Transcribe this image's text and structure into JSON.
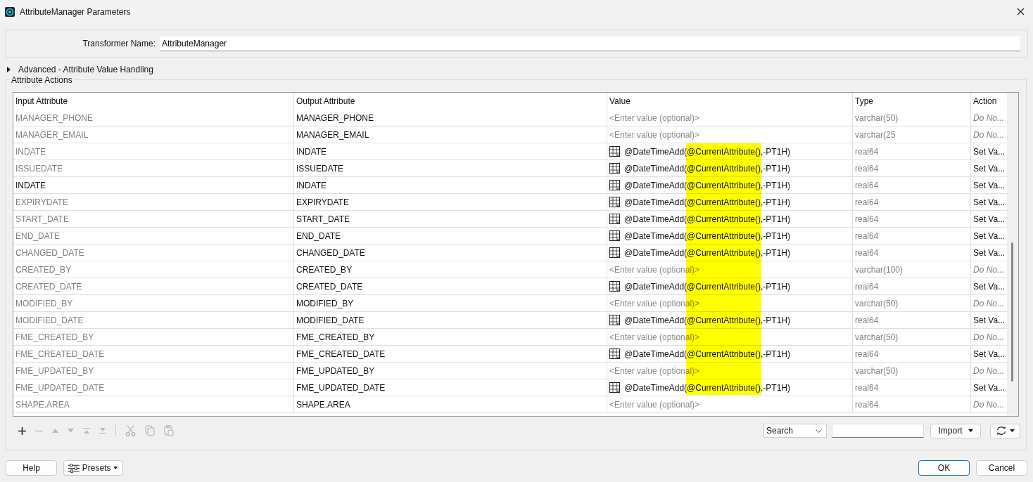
{
  "window": {
    "title": "AttributeManager Parameters"
  },
  "transformer_name": {
    "label": "Transformer Name:",
    "value": "AttributeManager"
  },
  "advanced": {
    "label": "Advanced - Attribute Value Handling",
    "expanded": false
  },
  "attribute_actions": {
    "title": "Attribute Actions",
    "highlight": true,
    "columns": [
      "Input Attribute",
      "Output Attribute",
      "Value",
      "Type",
      "Action"
    ],
    "rows": [
      {
        "input": "MANAGER_PHONE",
        "dimmed": true,
        "output": "MANAGER_PHONE",
        "kind": "placeholder",
        "value": "<Enter value (optional)>",
        "type": "varchar(50)",
        "action": "Do No...",
        "action_set": false
      },
      {
        "input": "MANAGER_EMAIL",
        "dimmed": true,
        "output": "MANAGER_EMAIL",
        "kind": "placeholder",
        "value": "<Enter value (optional)>",
        "type": "varchar(25",
        "action": "Do No...",
        "action_set": false
      },
      {
        "input": "INDATE",
        "dimmed": true,
        "output": "INDATE",
        "kind": "expression",
        "value": "@DateTimeAdd(@CurrentAttribute(),-PT1H)",
        "type": "real64",
        "action": "Set Va...",
        "action_set": true
      },
      {
        "input": "ISSUEDATE",
        "dimmed": true,
        "output": "ISSUEDATE",
        "kind": "expression",
        "value": "@DateTimeAdd(@CurrentAttribute(),-PT1H)",
        "type": "real64",
        "action": "Set Va...",
        "action_set": true
      },
      {
        "input": "INDATE",
        "dimmed": false,
        "output": "INDATE",
        "kind": "expression",
        "value": "@DateTimeAdd(@CurrentAttribute(),-PT1H)",
        "type": "real64",
        "action": "Set Va...",
        "action_set": true
      },
      {
        "input": "EXPIRYDATE",
        "dimmed": true,
        "output": "EXPIRYDATE",
        "kind": "expression",
        "value": "@DateTimeAdd(@CurrentAttribute(),-PT1H)",
        "type": "real64",
        "action": "Set Va...",
        "action_set": true
      },
      {
        "input": "START_DATE",
        "dimmed": true,
        "output": "START_DATE",
        "kind": "expression",
        "value": "@DateTimeAdd(@CurrentAttribute(),-PT1H)",
        "type": "real64",
        "action": "Set Va...",
        "action_set": true
      },
      {
        "input": "END_DATE",
        "dimmed": true,
        "output": "END_DATE",
        "kind": "expression",
        "value": "@DateTimeAdd(@CurrentAttribute(),-PT1H)",
        "type": "real64",
        "action": "Set Va...",
        "action_set": true
      },
      {
        "input": "CHANGED_DATE",
        "dimmed": true,
        "output": "CHANGED_DATE",
        "kind": "expression",
        "value": "@DateTimeAdd(@CurrentAttribute(),-PT1H)",
        "type": "real64",
        "action": "Set Va...",
        "action_set": true
      },
      {
        "input": "CREATED_BY",
        "dimmed": true,
        "output": "CREATED_BY",
        "kind": "placeholder",
        "value": "<Enter value (optional)>",
        "type": "varchar(100)",
        "action": "Do No...",
        "action_set": false
      },
      {
        "input": "CREATED_DATE",
        "dimmed": true,
        "output": "CREATED_DATE",
        "kind": "expression",
        "value": "@DateTimeAdd(@CurrentAttribute(),-PT1H)",
        "type": "real64",
        "action": "Set Va...",
        "action_set": true
      },
      {
        "input": "MODIFIED_BY",
        "dimmed": true,
        "output": "MODIFIED_BY",
        "kind": "placeholder",
        "value": "<Enter value (optional)>",
        "type": "varchar(50)",
        "action": "Do No...",
        "action_set": false
      },
      {
        "input": "MODIFIED_DATE",
        "dimmed": true,
        "output": "MODIFIED_DATE",
        "kind": "expression",
        "value": "@DateTimeAdd(@CurrentAttribute(),-PT1H)",
        "type": "real64",
        "action": "Set Va...",
        "action_set": true
      },
      {
        "input": "FME_CREATED_BY",
        "dimmed": true,
        "output": "FME_CREATED_BY",
        "kind": "placeholder",
        "value": "<Enter value (optional)>",
        "type": "varchar(50)",
        "action": "Do No...",
        "action_set": false
      },
      {
        "input": "FME_CREATED_DATE",
        "dimmed": true,
        "output": "FME_CREATED_DATE",
        "kind": "expression",
        "value": "@DateTimeAdd(@CurrentAttribute(),-PT1H)",
        "type": "real64",
        "action": "Set Va...",
        "action_set": true
      },
      {
        "input": "FME_UPDATED_BY",
        "dimmed": true,
        "output": "FME_UPDATED_BY",
        "kind": "placeholder",
        "value": "<Enter value (optional)>",
        "type": "varchar(50)",
        "action": "Do No...",
        "action_set": false
      },
      {
        "input": "FME_UPDATED_DATE",
        "dimmed": true,
        "output": "FME_UPDATED_DATE",
        "kind": "expression",
        "value": "@DateTimeAdd(@CurrentAttribute(),-PT1H)",
        "type": "real64",
        "action": "Set Va...",
        "action_set": true
      },
      {
        "input": "SHAPE.AREA",
        "dimmed": true,
        "output": "SHAPE.AREA",
        "kind": "placeholder",
        "value": "<Enter value (optional)>",
        "type": "real64",
        "action": "Do No...",
        "action_set": false
      }
    ],
    "search": {
      "label": "Search"
    },
    "import": "Import"
  },
  "buttons": {
    "help": "Help",
    "presets": "Presets",
    "ok": "OK",
    "cancel": "Cancel"
  }
}
